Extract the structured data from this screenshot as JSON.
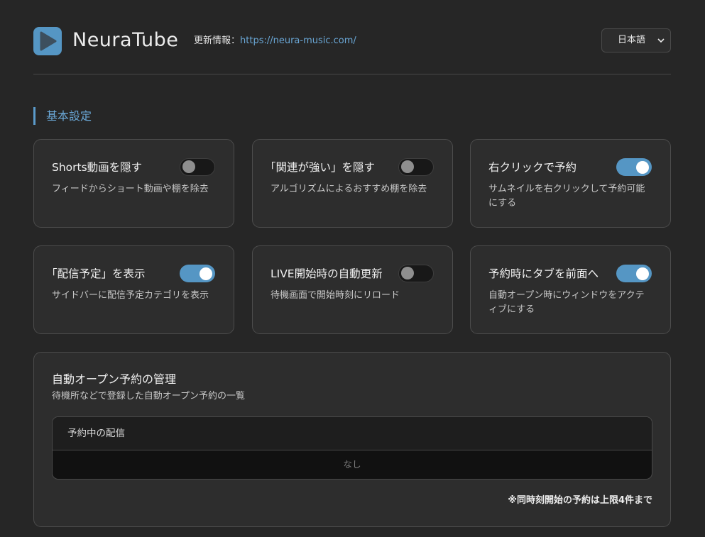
{
  "header": {
    "app_name": "NeuraTube",
    "update_label": "更新情報：",
    "update_link": "https://neura-music.com/",
    "language": {
      "selected": "日本語"
    }
  },
  "section": {
    "title": "基本設定"
  },
  "settings": [
    {
      "title": "Shorts動画を隠す",
      "description": "フィードからショート動画や棚を除去",
      "enabled": false
    },
    {
      "title": "「関連が強い」を隠す",
      "description": "アルゴリズムによるおすすめ棚を除去",
      "enabled": false
    },
    {
      "title": "右クリックで予約",
      "description": "サムネイルを右クリックして予約可能にする",
      "enabled": true
    },
    {
      "title": "「配信予定」を表示",
      "description": "サイドバーに配信予定カテゴリを表示",
      "enabled": true
    },
    {
      "title": "LIVE開始時の自動更新",
      "description": "待機画面で開始時刻にリロード",
      "enabled": false
    },
    {
      "title": "予約時にタブを前面へ",
      "description": "自動オープン時にウィンドウをアクティブにする",
      "enabled": true
    }
  ],
  "management": {
    "title": "自動オープン予約の管理",
    "description": "待機所などで登録した自動オープン予約の一覧",
    "table_header": "予約中の配信",
    "empty_text": "なし",
    "note": "※同時刻開始の予約は上限4件まで"
  },
  "colors": {
    "accent": "#5596c4",
    "background": "#262626",
    "card": "#2d2d2d"
  }
}
